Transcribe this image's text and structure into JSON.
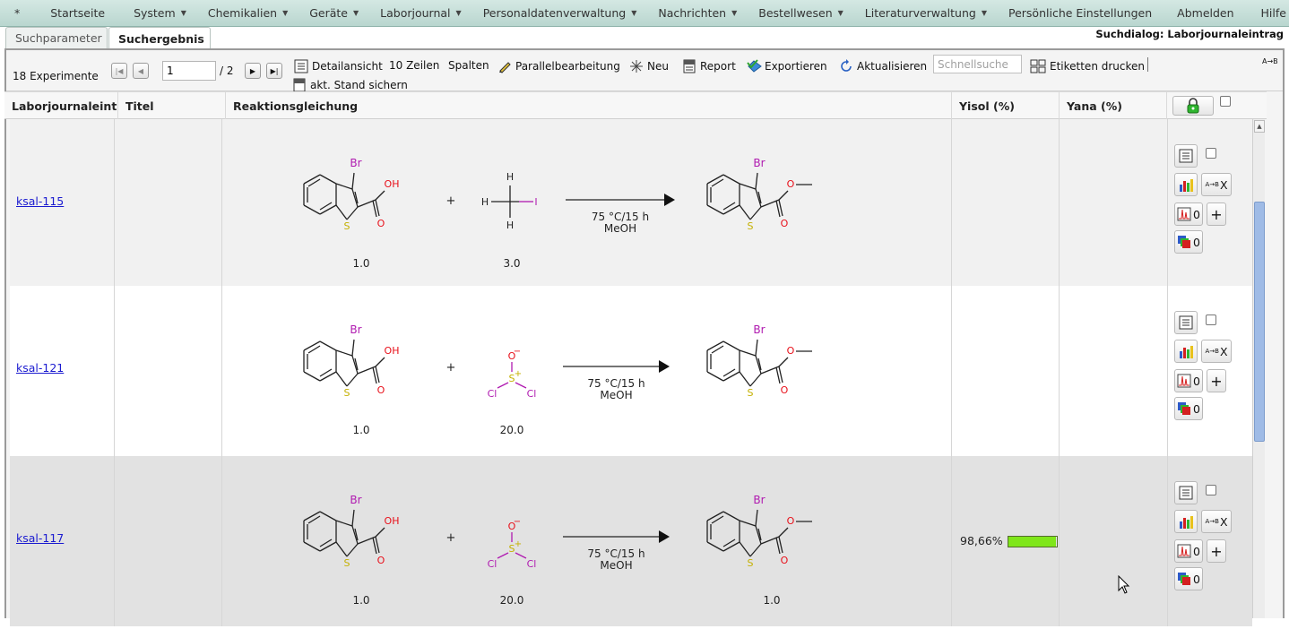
{
  "menu": {
    "items": [
      {
        "label": "*",
        "has_caret": false
      },
      {
        "label": "Startseite",
        "has_caret": false
      },
      {
        "label": "System",
        "has_caret": true
      },
      {
        "label": "Chemikalien",
        "has_caret": true
      },
      {
        "label": "Geräte",
        "has_caret": true
      },
      {
        "label": "Laborjournal",
        "has_caret": true
      },
      {
        "label": "Personaldatenverwaltung",
        "has_caret": true
      },
      {
        "label": "Nachrichten",
        "has_caret": true
      },
      {
        "label": "Bestellwesen",
        "has_caret": true
      },
      {
        "label": "Literaturverwaltung",
        "has_caret": true
      },
      {
        "label": "Persönliche Einstellungen",
        "has_caret": false
      },
      {
        "label": "Abmelden",
        "has_caret": false
      },
      {
        "label": "Hilfe",
        "has_caret": false
      }
    ]
  },
  "tabs": {
    "search_params": "Suchparameter",
    "search_result": "Suchergebnis"
  },
  "dialog_title": "Suchdialog: Laborjournaleintrag",
  "toolbar": {
    "count_label": "18 Experimente",
    "page_value": "1",
    "page_total": "/ 2",
    "detail_view": "Detailansicht",
    "rows": "10 Zeilen",
    "columns": "Spalten",
    "parallel_edit": "Parallelbearbeitung",
    "new": "Neu",
    "report": "Report",
    "export": "Exportieren",
    "refresh": "Aktualisieren",
    "quick_search_placeholder": "Schnellsuche",
    "print_labels": "Etiketten drucken",
    "save_state": "akt. Stand sichern",
    "atob": "A→B"
  },
  "table": {
    "headers": {
      "entry": "Laborjournaleintrag",
      "title": "Titel",
      "reaction": "Reaktionsgleichung",
      "yisol": "Yisol (%)",
      "yana": "Yana (%)"
    },
    "rows": [
      {
        "entry": "ksal-115",
        "reagent": "methyl-iodide",
        "coef_start": "1.0",
        "coef_reagent": "3.0",
        "coef_product": "",
        "conditions_temp": "75 °C/15 h",
        "conditions_solvent": "MeOH",
        "yisol_text": "",
        "yisol_fraction": null,
        "counts": {
          "analytics": "0",
          "samples": "0"
        }
      },
      {
        "entry": "ksal-121",
        "reagent": "thionyl-chloride",
        "coef_start": "1.0",
        "coef_reagent": "20.0",
        "coef_product": "",
        "conditions_temp": "75 °C/15 h",
        "conditions_solvent": "MeOH",
        "yisol_text": "",
        "yisol_fraction": null,
        "counts": {
          "analytics": "0",
          "samples": "0"
        }
      },
      {
        "entry": "ksal-117",
        "reagent": "thionyl-chloride",
        "coef_start": "1.0",
        "coef_reagent": "20.0",
        "coef_product": "1.0",
        "conditions_temp": "75 °C/15 h",
        "conditions_solvent": "MeOH",
        "yisol_text": "98,66%",
        "yisol_fraction": 0.9866,
        "counts": {
          "analytics": "0",
          "samples": "0"
        }
      }
    ]
  },
  "chem_labels": {
    "br": "Br",
    "s": "S",
    "oh": "OH",
    "o": "O",
    "h": "H",
    "i": "I",
    "cl": "Cl",
    "s_plus": "+",
    "o_minus": "−",
    "plus": "+",
    "x": "X",
    "add": "+",
    "atob": "A→B"
  },
  "colors": {
    "menubar": "#c6dfd8",
    "link": "#1a1ad0",
    "bromine": "#b01ab0",
    "oxygen": "#e8101a",
    "sulfur": "#c4b000",
    "iodine": "#b01ab0",
    "chlorine": "#b01ab0",
    "yield_bar": "#7fe61a"
  }
}
